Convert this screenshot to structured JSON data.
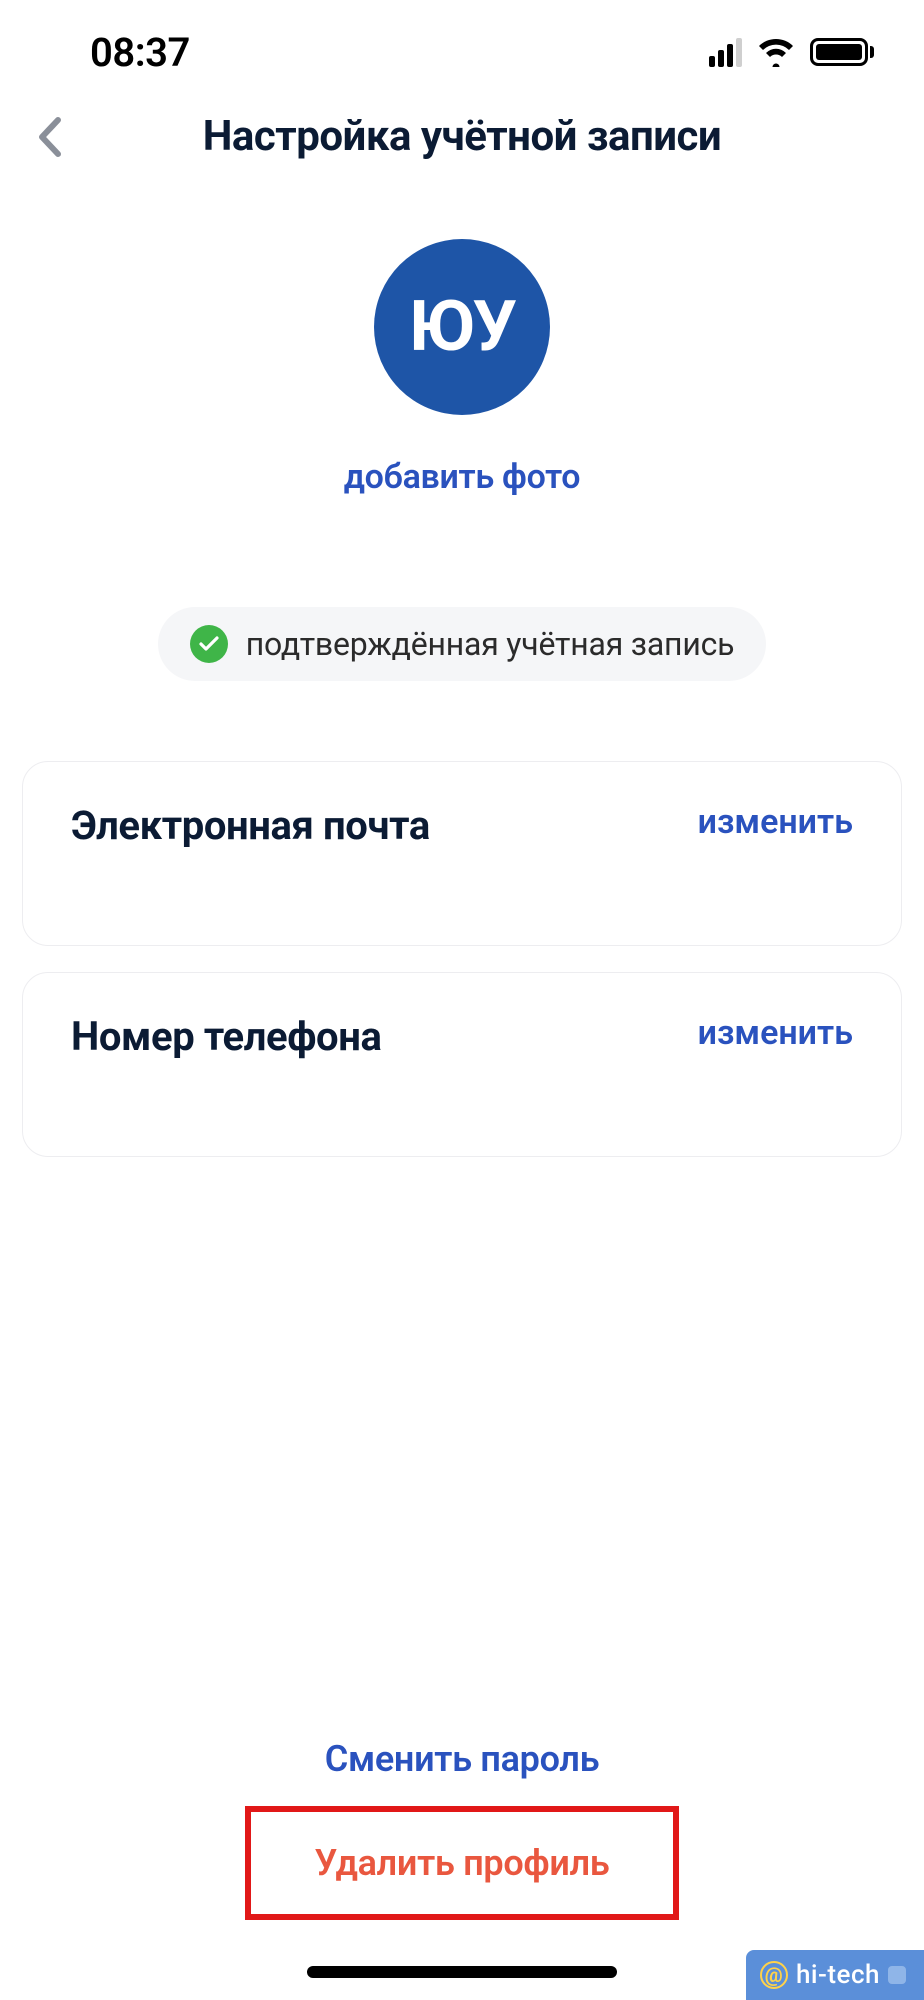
{
  "statusbar": {
    "time": "08:37"
  },
  "nav": {
    "title": "Настройка учётной записи"
  },
  "profile": {
    "initials": "ЮУ",
    "add_photo": "добавить фото"
  },
  "verification": {
    "text": "подтверждённая учётная запись"
  },
  "cards": {
    "email": {
      "title": "Электронная почта",
      "action": "изменить"
    },
    "phone": {
      "title": "Номер телефона",
      "action": "изменить"
    }
  },
  "bottom": {
    "change_password": "Сменить пароль",
    "delete_profile": "Удалить профиль"
  },
  "watermark": {
    "text": "hi-tech"
  },
  "colors": {
    "link": "#2a52be",
    "avatar_bg": "#1e55a7",
    "danger": "#e9573f",
    "highlight_border": "#e11818",
    "verified": "#3fb548"
  }
}
